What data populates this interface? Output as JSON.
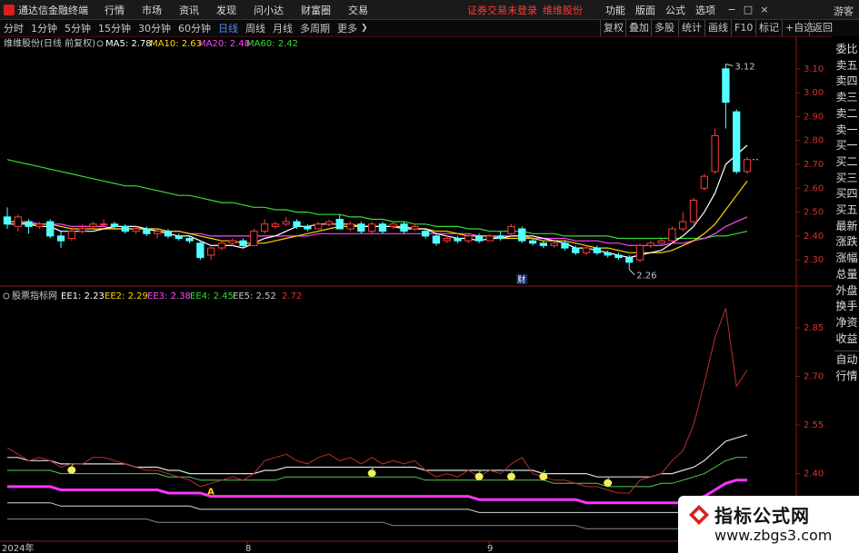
{
  "menubar": {
    "app_title": "通达信金融终端",
    "items": [
      "行情",
      "市场",
      "资讯",
      "发现",
      "问小达",
      "财富圈",
      "交易"
    ],
    "broker_text": "证券交易未登录",
    "stock_name_red": "维维股份",
    "right_items": [
      "功能",
      "版面",
      "公式",
      "选项"
    ],
    "guest_label": "游客",
    "win_min": "−",
    "win_max": "□",
    "win_close": "×"
  },
  "periodbar": {
    "periods": [
      "分时",
      "1分钟",
      "5分钟",
      "15分钟",
      "30分钟",
      "60分钟",
      "日线",
      "周线",
      "月线",
      "多周期",
      "更多"
    ],
    "active": "日线",
    "tools": [
      "复权",
      "叠加",
      "多股",
      "统计",
      "画线",
      "F10",
      "标记",
      "+自选",
      "返回"
    ]
  },
  "main_chart": {
    "stock_label": "维维股份(日线 前复权)",
    "ma": [
      {
        "label": "MA5:",
        "value": "2.78",
        "color": "#ffffff"
      },
      {
        "label": "MA10:",
        "value": "2.63",
        "color": "#ffd700"
      },
      {
        "label": "MA20:",
        "value": "2.48",
        "color": "#ff44ff"
      },
      {
        "label": "MA60:",
        "value": "2.42",
        "color": "#33dd33"
      }
    ],
    "price_ticks": [
      "3.10",
      "3.00",
      "2.90",
      "2.80",
      "2.70",
      "2.60",
      "2.50",
      "2.40",
      "2.30"
    ],
    "high_label": "3.12",
    "low_label": "2.26",
    "event_marker": "财"
  },
  "indicator_chart": {
    "title": "股票指标网",
    "values": [
      {
        "label": "EE1:",
        "value": "2.23",
        "color": "#ffffff"
      },
      {
        "label": "EE2:",
        "value": "2.29",
        "color": "#ffd700"
      },
      {
        "label": "EE3:",
        "value": "2.38",
        "color": "#ff44ff"
      },
      {
        "label": "EE4:",
        "value": "2.45",
        "color": "#33dd33"
      },
      {
        "label": "EE5:",
        "value": "2.52",
        "color": "#c8c8c8"
      },
      {
        "label": "",
        "value": "2.72",
        "color": "#d83030"
      }
    ],
    "ticks": [
      "2.85",
      "2.70",
      "2.55",
      "2.40"
    ],
    "signal_char": "A"
  },
  "xaxis": {
    "labels": [
      "2024年",
      "8",
      "9"
    ]
  },
  "sidebar": {
    "quote_tabs": [
      "委比",
      "卖五",
      "卖四",
      "卖三",
      "卖二",
      "卖一",
      "买一",
      "买二",
      "买三",
      "买四",
      "买五",
      "最新",
      "涨跌",
      "涨幅",
      "总量",
      "外盘",
      "换手",
      "净资",
      "收益"
    ],
    "lower_tabs": [
      "自动",
      "行情"
    ]
  },
  "watermark": {
    "title": "指标公式网",
    "url": "www.zbgs3.com"
  },
  "chart_data": {
    "type": "candlestick",
    "candles": [
      {
        "o": 2.48,
        "c": 2.45,
        "h": 2.52,
        "l": 2.43
      },
      {
        "o": 2.44,
        "c": 2.48,
        "h": 2.49,
        "l": 2.42
      },
      {
        "o": 2.46,
        "c": 2.44,
        "h": 2.47,
        "l": 2.41
      },
      {
        "o": 2.44,
        "c": 2.45,
        "h": 2.46,
        "l": 2.43
      },
      {
        "o": 2.46,
        "c": 2.4,
        "h": 2.47,
        "l": 2.39
      },
      {
        "o": 2.4,
        "c": 2.38,
        "h": 2.42,
        "l": 2.35
      },
      {
        "o": 2.39,
        "c": 2.42,
        "h": 2.43,
        "l": 2.38
      },
      {
        "o": 2.42,
        "c": 2.43,
        "h": 2.45,
        "l": 2.41
      },
      {
        "o": 2.44,
        "c": 2.45,
        "h": 2.46,
        "l": 2.43
      },
      {
        "o": 2.45,
        "c": 2.45,
        "h": 2.47,
        "l": 2.44
      },
      {
        "o": 2.45,
        "c": 2.44,
        "h": 2.46,
        "l": 2.43
      },
      {
        "o": 2.44,
        "c": 2.42,
        "h": 2.45,
        "l": 2.41
      },
      {
        "o": 2.42,
        "c": 2.43,
        "h": 2.44,
        "l": 2.41
      },
      {
        "o": 2.43,
        "c": 2.41,
        "h": 2.44,
        "l": 2.4
      },
      {
        "o": 2.41,
        "c": 2.42,
        "h": 2.43,
        "l": 2.39
      },
      {
        "o": 2.42,
        "c": 2.4,
        "h": 2.43,
        "l": 2.39
      },
      {
        "o": 2.4,
        "c": 2.39,
        "h": 2.41,
        "l": 2.38
      },
      {
        "o": 2.39,
        "c": 2.38,
        "h": 2.4,
        "l": 2.37
      },
      {
        "o": 2.37,
        "c": 2.31,
        "h": 2.38,
        "l": 2.3
      },
      {
        "o": 2.32,
        "c": 2.35,
        "h": 2.36,
        "l": 2.3
      },
      {
        "o": 2.35,
        "c": 2.37,
        "h": 2.38,
        "l": 2.34
      },
      {
        "o": 2.37,
        "c": 2.38,
        "h": 2.39,
        "l": 2.36
      },
      {
        "o": 2.38,
        "c": 2.36,
        "h": 2.39,
        "l": 2.35
      },
      {
        "o": 2.36,
        "c": 2.42,
        "h": 2.43,
        "l": 2.36
      },
      {
        "o": 2.42,
        "c": 2.45,
        "h": 2.47,
        "l": 2.41
      },
      {
        "o": 2.44,
        "c": 2.45,
        "h": 2.46,
        "l": 2.43
      },
      {
        "o": 2.45,
        "c": 2.46,
        "h": 2.48,
        "l": 2.44
      },
      {
        "o": 2.46,
        "c": 2.44,
        "h": 2.47,
        "l": 2.43
      },
      {
        "o": 2.44,
        "c": 2.43,
        "h": 2.45,
        "l": 2.42
      },
      {
        "o": 2.43,
        "c": 2.45,
        "h": 2.46,
        "l": 2.43
      },
      {
        "o": 2.45,
        "c": 2.46,
        "h": 2.47,
        "l": 2.44
      },
      {
        "o": 2.47,
        "c": 2.43,
        "h": 2.49,
        "l": 2.43
      },
      {
        "o": 2.43,
        "c": 2.45,
        "h": 2.46,
        "l": 2.42
      },
      {
        "o": 2.45,
        "c": 2.42,
        "h": 2.46,
        "l": 2.41
      },
      {
        "o": 2.42,
        "c": 2.45,
        "h": 2.46,
        "l": 2.41
      },
      {
        "o": 2.45,
        "c": 2.42,
        "h": 2.46,
        "l": 2.41
      },
      {
        "o": 2.44,
        "c": 2.45,
        "h": 2.46,
        "l": 2.43
      },
      {
        "o": 2.45,
        "c": 2.42,
        "h": 2.46,
        "l": 2.41
      },
      {
        "o": 2.43,
        "c": 2.44,
        "h": 2.45,
        "l": 2.42
      },
      {
        "o": 2.42,
        "c": 2.4,
        "h": 2.43,
        "l": 2.39
      },
      {
        "o": 2.4,
        "c": 2.37,
        "h": 2.41,
        "l": 2.36
      },
      {
        "o": 2.38,
        "c": 2.39,
        "h": 2.4,
        "l": 2.37
      },
      {
        "o": 2.39,
        "c": 2.38,
        "h": 2.4,
        "l": 2.37
      },
      {
        "o": 2.38,
        "c": 2.4,
        "h": 2.41,
        "l": 2.37
      },
      {
        "o": 2.4,
        "c": 2.38,
        "h": 2.41,
        "l": 2.37
      },
      {
        "o": 2.38,
        "c": 2.4,
        "h": 2.41,
        "l": 2.38
      },
      {
        "o": 2.4,
        "c": 2.39,
        "h": 2.42,
        "l": 2.38
      },
      {
        "o": 2.41,
        "c": 2.44,
        "h": 2.45,
        "l": 2.4
      },
      {
        "o": 2.43,
        "c": 2.38,
        "h": 2.44,
        "l": 2.37
      },
      {
        "o": 2.38,
        "c": 2.37,
        "h": 2.39,
        "l": 2.36
      },
      {
        "o": 2.37,
        "c": 2.36,
        "h": 2.38,
        "l": 2.35
      },
      {
        "o": 2.36,
        "c": 2.37,
        "h": 2.38,
        "l": 2.35
      },
      {
        "o": 2.37,
        "c": 2.35,
        "h": 2.38,
        "l": 2.34
      },
      {
        "o": 2.35,
        "c": 2.33,
        "h": 2.36,
        "l": 2.32
      },
      {
        "o": 2.33,
        "c": 2.35,
        "h": 2.36,
        "l": 2.32
      },
      {
        "o": 2.35,
        "c": 2.33,
        "h": 2.36,
        "l": 2.32
      },
      {
        "o": 2.33,
        "c": 2.32,
        "h": 2.34,
        "l": 2.31
      },
      {
        "o": 2.32,
        "c": 2.31,
        "h": 2.33,
        "l": 2.3
      },
      {
        "o": 2.31,
        "c": 2.29,
        "h": 2.32,
        "l": 2.26
      },
      {
        "o": 2.3,
        "c": 2.36,
        "h": 2.37,
        "l": 2.29
      },
      {
        "o": 2.36,
        "c": 2.37,
        "h": 2.38,
        "l": 2.35
      },
      {
        "o": 2.37,
        "c": 2.38,
        "h": 2.39,
        "l": 2.36
      },
      {
        "o": 2.38,
        "c": 2.43,
        "h": 2.44,
        "l": 2.37
      },
      {
        "o": 2.43,
        "c": 2.46,
        "h": 2.5,
        "l": 2.42
      },
      {
        "o": 2.46,
        "c": 2.55,
        "h": 2.56,
        "l": 2.45
      },
      {
        "o": 2.6,
        "c": 2.65,
        "h": 2.66,
        "l": 2.59
      },
      {
        "o": 2.67,
        "c": 2.82,
        "h": 2.85,
        "l": 2.66
      },
      {
        "o": 3.1,
        "c": 2.96,
        "h": 3.12,
        "l": 2.85
      },
      {
        "o": 2.92,
        "c": 2.67,
        "h": 2.93,
        "l": 2.66
      },
      {
        "o": 2.67,
        "c": 2.72,
        "h": 2.73,
        "l": 2.66
      }
    ],
    "ma5": [
      2.45,
      2.45,
      2.45,
      2.44,
      2.44,
      2.42,
      2.42,
      2.42,
      2.42,
      2.43,
      2.44,
      2.44,
      2.44,
      2.43,
      2.42,
      2.41,
      2.4,
      2.4,
      2.38,
      2.36,
      2.36,
      2.36,
      2.35,
      2.37,
      2.39,
      2.4,
      2.42,
      2.44,
      2.44,
      2.45,
      2.45,
      2.45,
      2.45,
      2.44,
      2.44,
      2.44,
      2.44,
      2.43,
      2.43,
      2.43,
      2.41,
      2.4,
      2.39,
      2.39,
      2.38,
      2.39,
      2.39,
      2.4,
      2.4,
      2.4,
      2.39,
      2.38,
      2.37,
      2.35,
      2.35,
      2.34,
      2.33,
      2.32,
      2.31,
      2.32,
      2.33,
      2.34,
      2.37,
      2.4,
      2.44,
      2.5,
      2.58,
      2.7,
      2.74,
      2.78
    ],
    "ma10": [
      2.46,
      2.46,
      2.45,
      2.45,
      2.45,
      2.44,
      2.43,
      2.43,
      2.43,
      2.43,
      2.43,
      2.43,
      2.43,
      2.43,
      2.43,
      2.42,
      2.42,
      2.41,
      2.4,
      2.39,
      2.38,
      2.38,
      2.37,
      2.37,
      2.37,
      2.38,
      2.39,
      2.4,
      2.41,
      2.42,
      2.43,
      2.44,
      2.44,
      2.44,
      2.44,
      2.44,
      2.44,
      2.44,
      2.43,
      2.43,
      2.42,
      2.42,
      2.41,
      2.4,
      2.4,
      2.4,
      2.39,
      2.39,
      2.39,
      2.39,
      2.38,
      2.38,
      2.38,
      2.37,
      2.36,
      2.35,
      2.35,
      2.34,
      2.33,
      2.33,
      2.33,
      2.33,
      2.34,
      2.36,
      2.38,
      2.41,
      2.45,
      2.51,
      2.57,
      2.63
    ],
    "ma20": [
      2.46,
      2.46,
      2.46,
      2.45,
      2.45,
      2.45,
      2.44,
      2.44,
      2.44,
      2.44,
      2.43,
      2.43,
      2.43,
      2.43,
      2.42,
      2.42,
      2.42,
      2.41,
      2.41,
      2.4,
      2.4,
      2.4,
      2.4,
      2.4,
      2.4,
      2.4,
      2.4,
      2.4,
      2.4,
      2.41,
      2.41,
      2.41,
      2.41,
      2.41,
      2.41,
      2.41,
      2.41,
      2.41,
      2.41,
      2.41,
      2.41,
      2.41,
      2.41,
      2.41,
      2.4,
      2.4,
      2.4,
      2.4,
      2.4,
      2.39,
      2.39,
      2.39,
      2.39,
      2.38,
      2.38,
      2.38,
      2.37,
      2.37,
      2.36,
      2.36,
      2.36,
      2.36,
      2.37,
      2.37,
      2.38,
      2.39,
      2.41,
      2.44,
      2.46,
      2.48
    ],
    "ma60": [
      2.72,
      2.71,
      2.7,
      2.69,
      2.68,
      2.67,
      2.66,
      2.65,
      2.64,
      2.63,
      2.62,
      2.61,
      2.61,
      2.6,
      2.59,
      2.58,
      2.57,
      2.57,
      2.56,
      2.55,
      2.54,
      2.54,
      2.53,
      2.52,
      2.52,
      2.51,
      2.51,
      2.5,
      2.5,
      2.49,
      2.49,
      2.49,
      2.48,
      2.48,
      2.47,
      2.47,
      2.46,
      2.46,
      2.45,
      2.45,
      2.44,
      2.44,
      2.44,
      2.43,
      2.43,
      2.42,
      2.42,
      2.42,
      2.42,
      2.41,
      2.41,
      2.41,
      2.4,
      2.4,
      2.4,
      2.4,
      2.4,
      2.39,
      2.39,
      2.39,
      2.39,
      2.39,
      2.39,
      2.39,
      2.39,
      2.39,
      2.4,
      2.4,
      2.41,
      2.42
    ],
    "price_ylim": [
      2.24,
      3.16
    ],
    "indicator": {
      "ylim": [
        2.2,
        2.92
      ],
      "red": [
        2.48,
        2.46,
        2.44,
        2.45,
        2.44,
        2.42,
        2.43,
        2.43,
        2.45,
        2.45,
        2.44,
        2.43,
        2.42,
        2.41,
        2.41,
        2.4,
        2.39,
        2.38,
        2.36,
        2.37,
        2.38,
        2.39,
        2.38,
        2.4,
        2.44,
        2.45,
        2.46,
        2.44,
        2.43,
        2.45,
        2.46,
        2.44,
        2.45,
        2.43,
        2.45,
        2.43,
        2.44,
        2.43,
        2.44,
        2.41,
        2.39,
        2.4,
        2.39,
        2.41,
        2.39,
        2.41,
        2.4,
        2.43,
        2.45,
        2.4,
        2.39,
        2.38,
        2.38,
        2.37,
        2.36,
        2.36,
        2.35,
        2.34,
        2.34,
        2.38,
        2.39,
        2.4,
        2.44,
        2.47,
        2.55,
        2.68,
        2.82,
        2.91,
        2.67,
        2.72
      ],
      "white": [
        2.45,
        2.45,
        2.44,
        2.44,
        2.44,
        2.43,
        2.43,
        2.43,
        2.43,
        2.43,
        2.43,
        2.43,
        2.42,
        2.42,
        2.42,
        2.41,
        2.41,
        2.4,
        2.4,
        2.4,
        2.4,
        2.4,
        2.4,
        2.4,
        2.41,
        2.41,
        2.42,
        2.42,
        2.42,
        2.42,
        2.42,
        2.42,
        2.42,
        2.42,
        2.42,
        2.42,
        2.42,
        2.42,
        2.42,
        2.41,
        2.41,
        2.41,
        2.41,
        2.41,
        2.41,
        2.41,
        2.41,
        2.41,
        2.41,
        2.41,
        2.4,
        2.4,
        2.4,
        2.4,
        2.4,
        2.39,
        2.39,
        2.39,
        2.39,
        2.39,
        2.39,
        2.4,
        2.4,
        2.41,
        2.42,
        2.44,
        2.47,
        2.5,
        2.51,
        2.52
      ],
      "green": [
        2.41,
        2.41,
        2.41,
        2.41,
        2.41,
        2.4,
        2.4,
        2.4,
        2.4,
        2.4,
        2.4,
        2.4,
        2.4,
        2.4,
        2.4,
        2.39,
        2.39,
        2.39,
        2.38,
        2.38,
        2.38,
        2.38,
        2.38,
        2.38,
        2.38,
        2.38,
        2.39,
        2.39,
        2.39,
        2.39,
        2.39,
        2.39,
        2.39,
        2.39,
        2.39,
        2.39,
        2.39,
        2.39,
        2.39,
        2.38,
        2.38,
        2.38,
        2.38,
        2.38,
        2.38,
        2.38,
        2.38,
        2.38,
        2.38,
        2.38,
        2.38,
        2.37,
        2.37,
        2.37,
        2.37,
        2.37,
        2.36,
        2.36,
        2.36,
        2.36,
        2.36,
        2.37,
        2.37,
        2.38,
        2.39,
        2.4,
        2.42,
        2.44,
        2.45,
        2.45
      ],
      "magenta": [
        2.36,
        2.36,
        2.36,
        2.36,
        2.36,
        2.35,
        2.35,
        2.35,
        2.35,
        2.35,
        2.35,
        2.35,
        2.35,
        2.35,
        2.35,
        2.34,
        2.34,
        2.34,
        2.34,
        2.33,
        2.33,
        2.33,
        2.33,
        2.33,
        2.33,
        2.33,
        2.33,
        2.33,
        2.33,
        2.33,
        2.33,
        2.33,
        2.33,
        2.33,
        2.33,
        2.33,
        2.33,
        2.33,
        2.33,
        2.33,
        2.33,
        2.33,
        2.33,
        2.33,
        2.32,
        2.32,
        2.32,
        2.32,
        2.32,
        2.32,
        2.32,
        2.32,
        2.32,
        2.32,
        2.31,
        2.31,
        2.31,
        2.31,
        2.31,
        2.31,
        2.31,
        2.31,
        2.31,
        2.31,
        2.32,
        2.33,
        2.35,
        2.37,
        2.38,
        2.38
      ],
      "yellow": [
        2.31,
        2.31,
        2.31,
        2.31,
        2.31,
        2.3,
        2.3,
        2.3,
        2.3,
        2.3,
        2.3,
        2.3,
        2.3,
        2.3,
        2.3,
        2.3,
        2.3,
        2.3,
        2.29,
        2.29,
        2.29,
        2.29,
        2.29,
        2.29,
        2.29,
        2.29,
        2.29,
        2.29,
        2.29,
        2.29,
        2.29,
        2.29,
        2.29,
        2.29,
        2.29,
        2.29,
        2.29,
        2.29,
        2.29,
        2.29,
        2.29,
        2.29,
        2.29,
        2.29,
        2.28,
        2.28,
        2.28,
        2.28,
        2.28,
        2.28,
        2.28,
        2.28,
        2.28,
        2.28,
        2.28,
        2.28,
        2.28,
        2.28,
        2.28,
        2.28,
        2.28,
        2.28,
        2.28,
        2.28,
        2.28,
        2.28,
        2.29,
        2.29,
        2.29,
        2.29
      ],
      "gray": [
        2.26,
        2.26,
        2.26,
        2.26,
        2.26,
        2.26,
        2.26,
        2.26,
        2.26,
        2.26,
        2.26,
        2.26,
        2.26,
        2.26,
        2.25,
        2.25,
        2.25,
        2.25,
        2.25,
        2.25,
        2.25,
        2.25,
        2.25,
        2.25,
        2.25,
        2.25,
        2.25,
        2.25,
        2.25,
        2.25,
        2.25,
        2.25,
        2.25,
        2.25,
        2.25,
        2.25,
        2.24,
        2.24,
        2.24,
        2.24,
        2.24,
        2.24,
        2.24,
        2.24,
        2.24,
        2.24,
        2.24,
        2.24,
        2.24,
        2.24,
        2.24,
        2.24,
        2.24,
        2.24,
        2.23,
        2.23,
        2.23,
        2.23,
        2.23,
        2.23,
        2.23,
        2.23,
        2.23,
        2.23,
        2.23,
        2.23,
        2.23,
        2.23,
        2.23,
        2.23
      ],
      "signals": [
        6,
        19,
        34,
        44,
        47,
        50,
        56
      ]
    }
  }
}
